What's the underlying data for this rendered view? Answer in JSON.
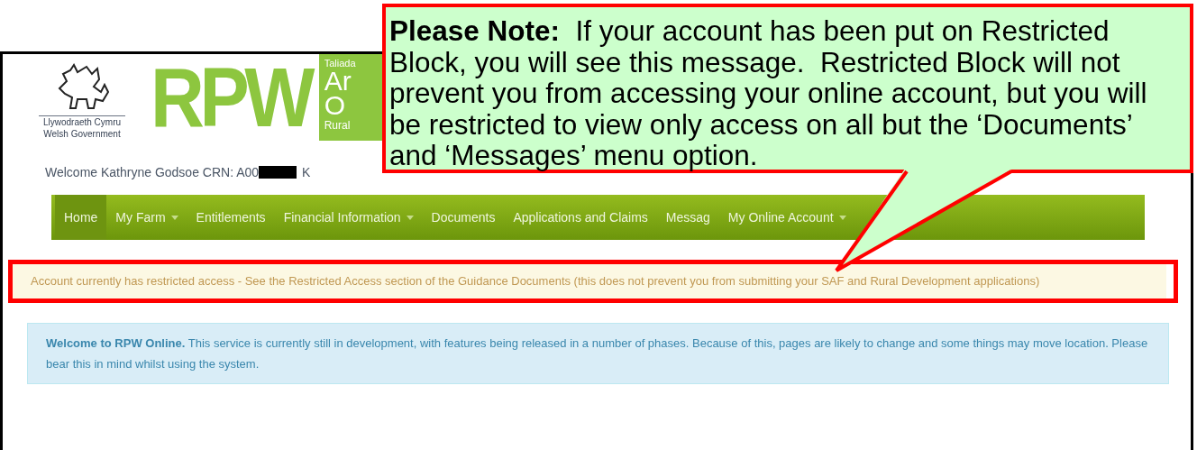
{
  "header": {
    "org_name": "Llywodraeth Cymru",
    "org_name_en": "Welsh Government",
    "brand": "RPW",
    "banner_lines": [
      "Taliada",
      "Ar",
      "O",
      "Rural"
    ]
  },
  "welcome": {
    "text": "Welcome Kathryne Godsoe CRN: A00",
    "after": "K"
  },
  "nav": [
    {
      "label": "Home",
      "dropdown": false,
      "selected": true
    },
    {
      "label": "My Farm",
      "dropdown": true,
      "selected": false
    },
    {
      "label": "Entitlements",
      "dropdown": false,
      "selected": false
    },
    {
      "label": "Financial Information",
      "dropdown": true,
      "selected": false
    },
    {
      "label": "Documents",
      "dropdown": false,
      "selected": false
    },
    {
      "label": "Applications and Claims",
      "dropdown": false,
      "selected": false
    },
    {
      "label": "Messag",
      "dropdown": false,
      "selected": false
    },
    {
      "label": "My Online Account",
      "dropdown": true,
      "selected": false
    }
  ],
  "alerts": [
    {
      "kind": "warning",
      "text": "Account currently has restricted access - See the Restricted Access section of the Guidance Documents (this does not prevent you from submitting your SAF and Rural Development applications)",
      "highlighted": true
    },
    {
      "kind": "info",
      "text": "**Welcome to RPW Online.** This service is currently still in development, with features being released in a number of phases. Because of this, pages are likely to change and some things may move location. Please bear this in mind whilst using the system.",
      "highlighted": false
    }
  ],
  "callout": {
    "text": "**Please Note:**  If your account has been put on Restricted Block, you will see this message.  Restricted Block will not prevent you from accessing your online account, but you will be restricted to view only access on all but the ‘Documents’ and ‘Messages’ menu option."
  }
}
